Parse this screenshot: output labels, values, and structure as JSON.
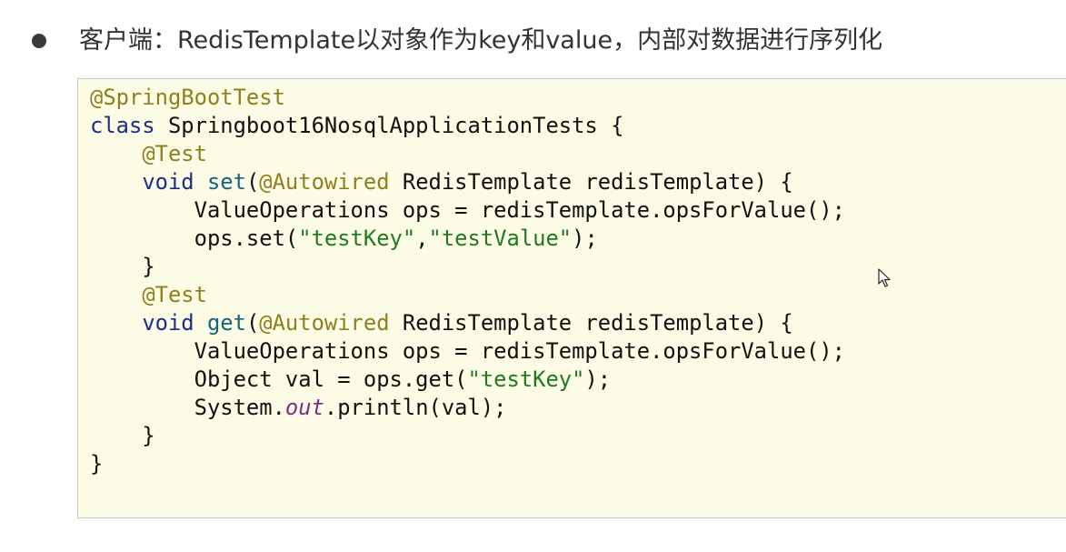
{
  "bullet": {
    "text": "客户端：RedisTemplate以对象作为key和value，内部对数据进行序列化"
  },
  "code": {
    "l1": {
      "a": "@SpringBootTest"
    },
    "l2": {
      "kw": "class",
      "rest": " Springboot16NosqlApplicationTests {"
    },
    "l3": {
      "a": "@Test"
    },
    "l4": {
      "kw": "void",
      "m": "set",
      "p1": "(",
      "a": "@Autowired",
      "p2": " RedisTemplate redisTemplate) {"
    },
    "l5": {
      "t": "ValueOperations ops = redisTemplate.opsForValue();"
    },
    "l6": {
      "p1": "ops.set(",
      "s1": "\"testKey\"",
      "p2": ",",
      "s2": "\"testValue\"",
      "p3": ");"
    },
    "l7": {
      "t": "}"
    },
    "l8": {
      "a": "@Test"
    },
    "l9": {
      "kw": "void",
      "m": "get",
      "p1": "(",
      "a": "@Autowired",
      "p2": " RedisTemplate redisTemplate) {"
    },
    "l10": {
      "t": "ValueOperations ops = redisTemplate.opsForValue();"
    },
    "l11": {
      "p1": "Object val = ops.get(",
      "s1": "\"testKey\"",
      "p2": ");"
    },
    "l12": {
      "p1": "System.",
      "f": "out",
      "p2": ".println(val);"
    },
    "l13": {
      "t": "}"
    },
    "l14": {
      "t": "}"
    }
  }
}
